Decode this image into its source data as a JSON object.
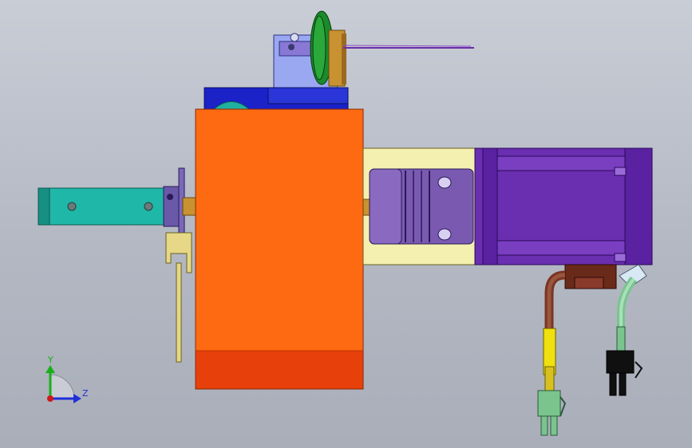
{
  "triad": {
    "y_label": "Y",
    "z_label": "Z",
    "y_color": "#18b018",
    "z_color": "#2030d8",
    "x_color": "#d01818"
  },
  "colors": {
    "background_top": "#c9cdd6",
    "housing": "#fd6a12",
    "housing_bottom": "#e8400a",
    "shaft": "#1fb7a7",
    "motor": "#6a2eb0",
    "motor_dark": "#4a1a8a",
    "adapter": "#f4f0b0",
    "bracket": "#1a22c8",
    "bracket_light": "#9aa8f2",
    "pulley": "#1a8a2a",
    "encoder_cable": "#7a3520",
    "connector": "#7ac48e",
    "wire": "#6a2ea8"
  }
}
